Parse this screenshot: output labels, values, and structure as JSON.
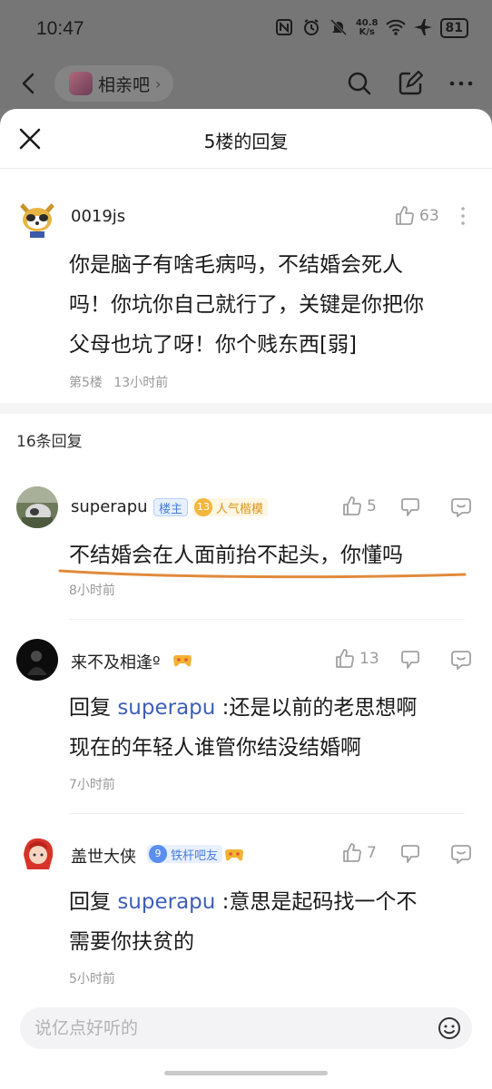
{
  "status_bar": {
    "time": "10:47",
    "net_speed_value": "40.8",
    "net_speed_unit": "K/s",
    "battery": "81",
    "icons": [
      "nfc-icon",
      "alarm-icon",
      "mute-icon",
      "wifi-icon",
      "airplane-icon",
      "battery-icon"
    ]
  },
  "topnav": {
    "forum_name": "相亲吧",
    "chevron": "›",
    "icons": [
      "back-icon",
      "search-icon",
      "edit-icon",
      "more-icon"
    ]
  },
  "sheet": {
    "title": "5楼的回复",
    "close_icon": "close-icon"
  },
  "main_post": {
    "username": "0019js",
    "likes": "63",
    "text_lines": [
      "你是脑子有啥毛病吗，不结婚会死人",
      "吗！你坑你自己就行了，关键是你把你",
      "父母也坑了呀！你个贱东西[弱]"
    ],
    "floor": "第5楼",
    "time": "13小时前"
  },
  "reply_count": "16条回复",
  "replies": [
    {
      "username": "superapu",
      "host_badge": "楼主",
      "level": "13",
      "title_badge": "人气楷模",
      "likes": "5",
      "text": "不结婚会在人面前抬不起头，你懂吗",
      "time": "8小时前"
    },
    {
      "username": "来不及相逢º",
      "likes": "13",
      "reply_prefix": "回复",
      "reply_to": "superapu",
      "text_first": ":还是以前的老思想啊",
      "text_second": "现在的年轻人谁管你结没结婚啊",
      "time": "7小时前"
    },
    {
      "username": "盖世大侠",
      "level": "9",
      "title_badge": "铁杆吧友",
      "likes": "7",
      "reply_prefix": "回复",
      "reply_to": "superapu",
      "text_first": ":意思是起码找一个不",
      "text_second": "需要你扶贫的",
      "time": "5小时前"
    }
  ],
  "input": {
    "placeholder": "说亿点好听的"
  },
  "colors": {
    "link": "#3d5fb8",
    "underline_annotation": "#e08a3c",
    "overlay": "#767676"
  }
}
